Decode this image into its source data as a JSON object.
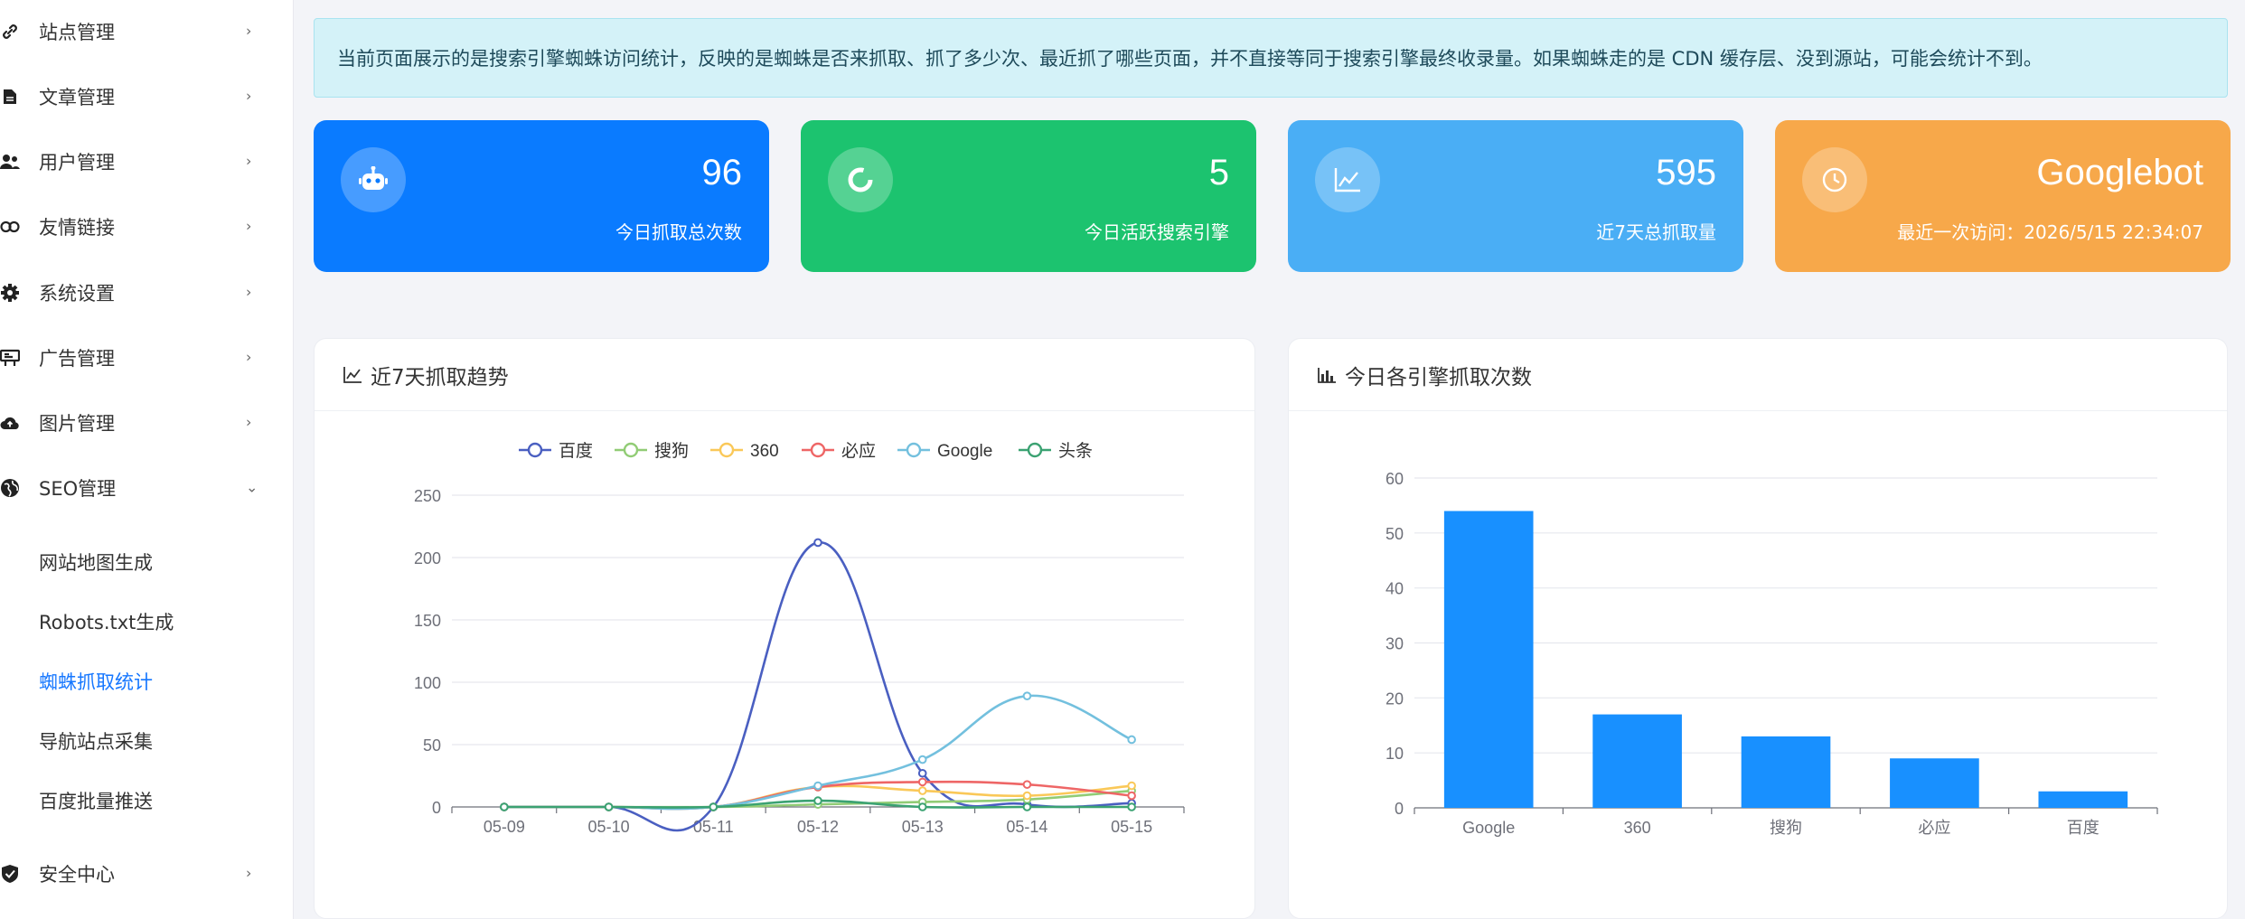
{
  "sidebar": {
    "items": [
      {
        "label": "站点管理",
        "icon": "link-icon"
      },
      {
        "label": "文章管理",
        "icon": "file-icon"
      },
      {
        "label": "用户管理",
        "icon": "users-icon"
      },
      {
        "label": "友情链接",
        "icon": "chain-icon"
      },
      {
        "label": "系统设置",
        "icon": "gear-icon"
      },
      {
        "label": "广告管理",
        "icon": "billboard-icon"
      },
      {
        "label": "图片管理",
        "icon": "cloud-upload-icon"
      },
      {
        "label": "SEO管理",
        "icon": "globe-icon"
      }
    ],
    "seo_children": [
      "网站地图生成",
      "Robots.txt生成",
      "蜘蛛抓取统计",
      "导航站点采集",
      "百度批量推送"
    ],
    "security": {
      "label": "安全中心",
      "icon": "shield-check-icon"
    },
    "chevron_right": "›",
    "chevron_down": "⌄"
  },
  "notice": "当前页面展示的是搜索引擎蜘蛛访问统计，反映的是蜘蛛是否来抓取、抓了多少次、最近抓了哪些页面，并不直接等同于搜索引擎最终收录量。如果蜘蛛走的是 CDN 缓存层、没到源站，可能会统计不到。",
  "stats": [
    {
      "value": "96",
      "label": "今日抓取总次数",
      "color": "#0a7bff",
      "icon": "robot-icon"
    },
    {
      "value": "5",
      "label": "今日活跃搜索引擎",
      "color": "#1cc36f",
      "icon": "refresh-ring-icon"
    },
    {
      "value": "595",
      "label": "近7天总抓取量",
      "color": "#4aaef5",
      "icon": "line-chart-icon"
    },
    {
      "value": "Googlebot",
      "label": "最近一次访问：2026/5/15 22:34:07",
      "color": "#f7a84a",
      "icon": "clock-icon"
    }
  ],
  "trend_card": {
    "title": "近7天抓取趋势"
  },
  "bar_card": {
    "title": "今日各引擎抓取次数"
  },
  "chart_data": [
    {
      "type": "line",
      "x": [
        "05-09",
        "05-10",
        "05-11",
        "05-12",
        "05-13",
        "05-14",
        "05-15"
      ],
      "ylim": [
        0,
        250
      ],
      "yticks": [
        0,
        50,
        100,
        150,
        200,
        250
      ],
      "legend_position": "top",
      "grid": true,
      "series": [
        {
          "name": "百度",
          "color": "#4a5fc1",
          "values": [
            0,
            0,
            0,
            212,
            27,
            2,
            3
          ]
        },
        {
          "name": "搜狗",
          "color": "#91cc75",
          "values": [
            0,
            0,
            0,
            2,
            4,
            6,
            13
          ]
        },
        {
          "name": "360",
          "color": "#fac858",
          "values": [
            0,
            0,
            0,
            16,
            13,
            9,
            17
          ]
        },
        {
          "name": "必应",
          "color": "#ee6666",
          "values": [
            0,
            0,
            0,
            16,
            20,
            18,
            9
          ]
        },
        {
          "name": "Google",
          "color": "#73c0de",
          "values": [
            0,
            0,
            0,
            17,
            38,
            89,
            54
          ]
        },
        {
          "name": "头条",
          "color": "#3ba272",
          "values": [
            0,
            0,
            0,
            5,
            0,
            0,
            0
          ]
        }
      ]
    },
    {
      "type": "bar",
      "categories": [
        "Google",
        "360",
        "搜狗",
        "必应",
        "百度"
      ],
      "values": [
        54,
        17,
        13,
        9,
        3
      ],
      "ylim": [
        0,
        60
      ],
      "yticks": [
        0,
        10,
        20,
        30,
        40,
        50,
        60
      ],
      "color": "#1890ff",
      "grid": true
    }
  ]
}
